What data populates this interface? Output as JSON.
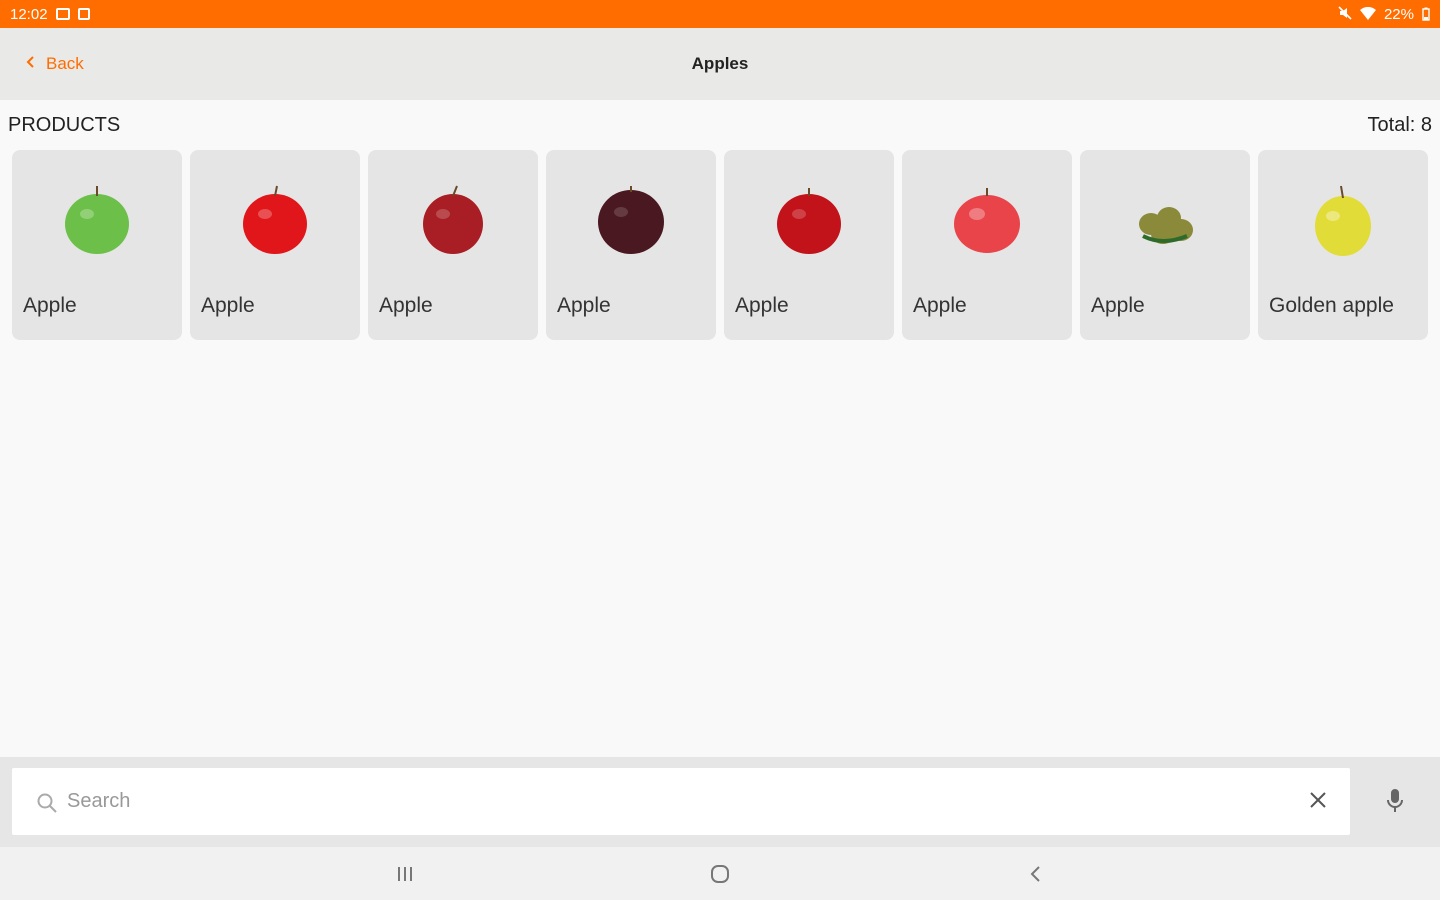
{
  "status_bar": {
    "time": "12:02",
    "battery": "22%",
    "icons": [
      "gallery-icon",
      "sim-icon",
      "mute-icon",
      "wifi-icon",
      "battery-icon"
    ]
  },
  "toolbar": {
    "back_label": "Back",
    "title": "Apples"
  },
  "section": {
    "title": "PRODUCTS",
    "total": "Total: 8"
  },
  "products": [
    {
      "name": "Apple",
      "color": "#6cc04a"
    },
    {
      "name": "Apple",
      "color": "#e0161a"
    },
    {
      "name": "Apple",
      "color": "#a81e24"
    },
    {
      "name": "Apple",
      "color": "#4a1820"
    },
    {
      "name": "Apple",
      "color": "#c2121a"
    },
    {
      "name": "Apple",
      "color": "#e8444a"
    },
    {
      "name": "Apple",
      "color": "#8a8a3a"
    },
    {
      "name": "Golden apple",
      "color": "#e2dc38"
    }
  ],
  "search": {
    "placeholder": "Search",
    "value": ""
  },
  "colors": {
    "accent": "#ff6d00",
    "toolbar_bg": "#e9e9e7",
    "card_bg": "#e5e5e5"
  }
}
